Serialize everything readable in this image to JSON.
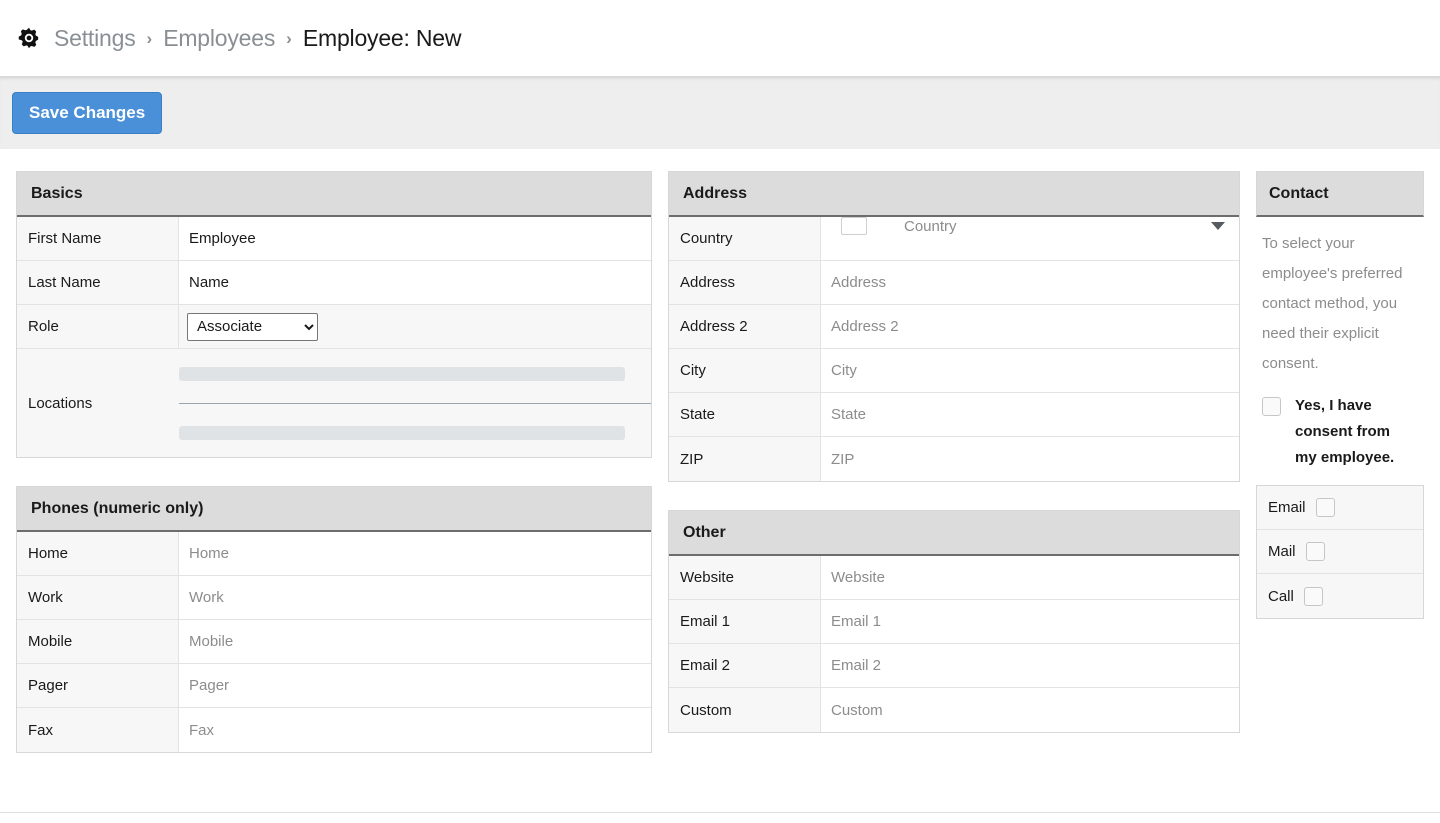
{
  "breadcrumb": {
    "icon": "gear-icon",
    "separator": "›",
    "items": [
      {
        "label": "Settings",
        "current": false
      },
      {
        "label": "Employees",
        "current": false
      },
      {
        "label": "Employee: New",
        "current": true
      }
    ]
  },
  "toolbar": {
    "save_label": "Save Changes",
    "save_color": "#4a90d9"
  },
  "basics": {
    "title": "Basics",
    "rows": [
      {
        "label": "First Name",
        "value": "Employee",
        "kind": "text-filled"
      },
      {
        "label": "Last Name",
        "value": "Name",
        "kind": "text-filled"
      },
      {
        "label": "Role",
        "value": "Associate",
        "kind": "select"
      }
    ],
    "role_options": [
      "Associate"
    ],
    "locations": {
      "label": "Locations",
      "kind": "placeholder-bars",
      "bar_count": 2
    }
  },
  "phones": {
    "title": "Phones (numeric only)",
    "rows": [
      {
        "label": "Home",
        "placeholder": "Home"
      },
      {
        "label": "Work",
        "placeholder": "Work"
      },
      {
        "label": "Mobile",
        "placeholder": "Mobile"
      },
      {
        "label": "Pager",
        "placeholder": "Pager"
      },
      {
        "label": "Fax",
        "placeholder": "Fax"
      }
    ]
  },
  "address": {
    "title": "Address",
    "country": {
      "label": "Country",
      "placeholder": "Country",
      "flag_icon": "flag-placeholder-icon",
      "caret_icon": "chevron-down-icon"
    },
    "rows": [
      {
        "label": "Address",
        "placeholder": "Address"
      },
      {
        "label": "Address 2",
        "placeholder": "Address 2"
      },
      {
        "label": "City",
        "placeholder": "City"
      },
      {
        "label": "State",
        "placeholder": "State"
      },
      {
        "label": "ZIP",
        "placeholder": "ZIP"
      }
    ]
  },
  "other": {
    "title": "Other",
    "rows": [
      {
        "label": "Website",
        "placeholder": "Website"
      },
      {
        "label": "Email 1",
        "placeholder": "Email 1"
      },
      {
        "label": "Email 2",
        "placeholder": "Email 2"
      },
      {
        "label": "Custom",
        "placeholder": "Custom"
      }
    ]
  },
  "contact": {
    "title": "Contact",
    "note": "To select your employee's preferred contact method, you need their explicit consent.",
    "consent_label": "Yes, I have consent from my employee.",
    "consent_checked": false,
    "methods": [
      {
        "label": "Email",
        "checked": false
      },
      {
        "label": "Mail",
        "checked": false
      },
      {
        "label": "Call",
        "checked": false
      }
    ]
  }
}
